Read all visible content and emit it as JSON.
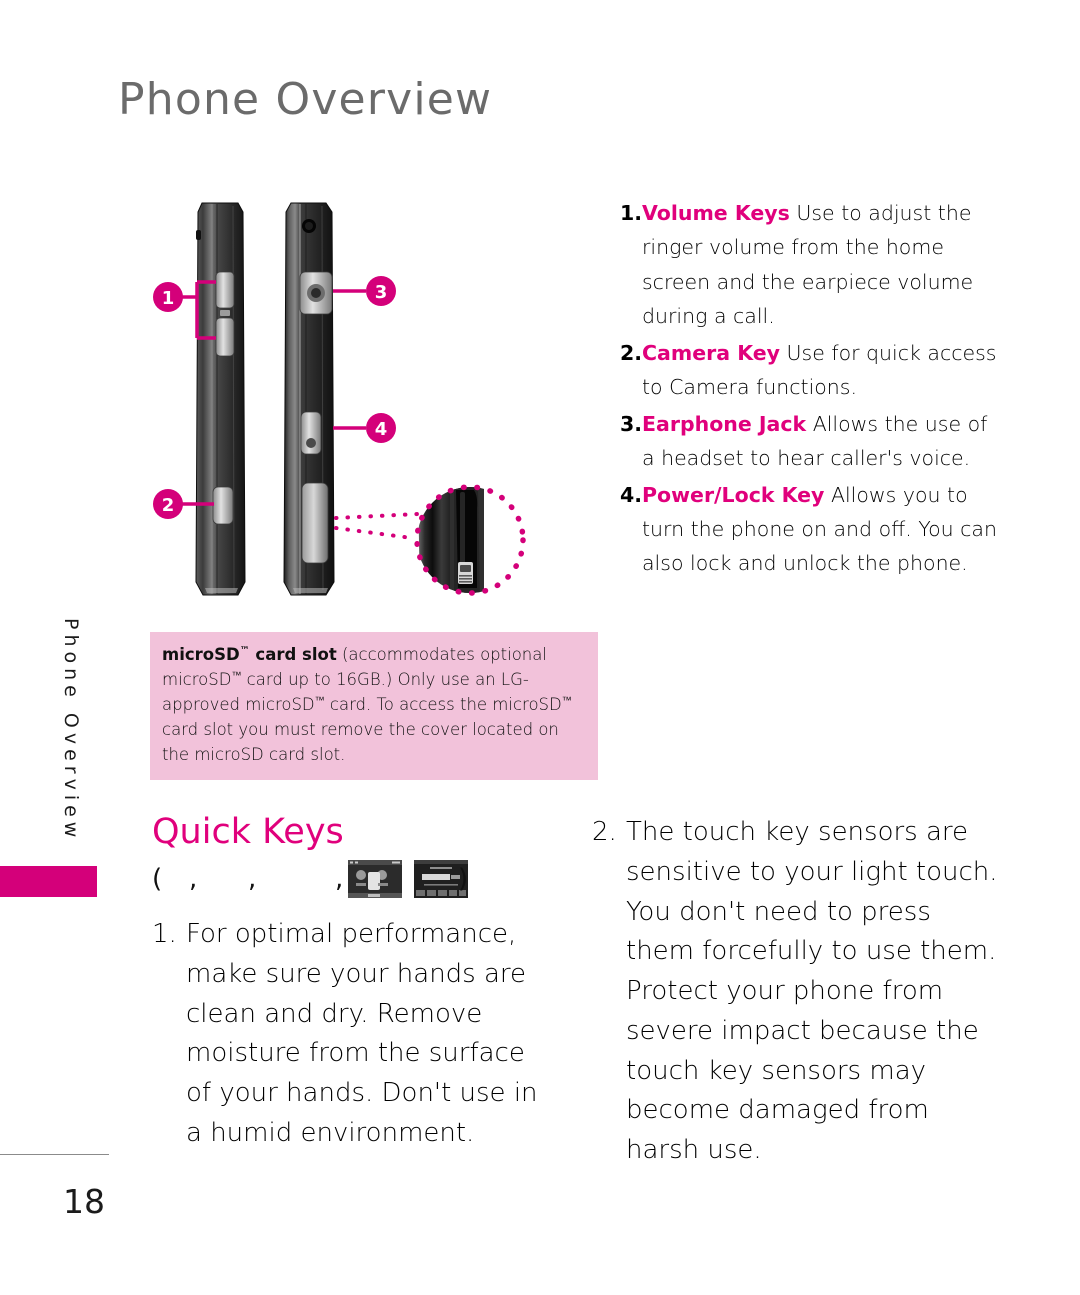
{
  "page": {
    "title": "Phone Overview",
    "side_tab_label": "Phone Overview",
    "page_number": "18"
  },
  "colors": {
    "magenta": "#e0007c",
    "tab_block": "#d4007a",
    "note_background": "#f2c2da",
    "title_gray": "#6b6b6b"
  },
  "illustration": {
    "callouts": [
      {
        "number": "1",
        "target": "volume-keys"
      },
      {
        "number": "2",
        "target": "camera-key"
      },
      {
        "number": "3",
        "target": "earphone-jack"
      },
      {
        "number": "4",
        "target": "power-lock-key"
      }
    ],
    "detail_circle": "microsd-card-slot-closeup"
  },
  "feature_list": [
    {
      "num": "1.",
      "label": "Volume Keys",
      "text": " Use to adjust the ringer volume from the home screen and the earpiece volume during a call."
    },
    {
      "num": "2.",
      "label": "Camera Key",
      "text": " Use for quick access to Camera functions."
    },
    {
      "num": "3.",
      "label": "Earphone Jack",
      "text": " Allows the use of a headset to hear caller's voice."
    },
    {
      "num": "4.",
      "label": "Power/Lock Key",
      "text": " Allows you to turn the phone on and off. You can also lock and unlock the phone."
    }
  ],
  "note": {
    "bold_lead": "microSD",
    "bold_lead_tm": "™",
    "bold_rest": " card slot",
    "body_1": " (accommodates optional microSD",
    "tm": "™",
    "body_2": " card up to 16GB.) Only use an LG-approved microSD",
    "body_3": " card. To access the microSD",
    "body_4": " card slot you must remove the cover located on the microSD card slot."
  },
  "quick_keys": {
    "heading": "Quick Keys",
    "paren_open": "(",
    "comma": ",",
    "paren_close": ")",
    "thumbnails": [
      {
        "name": "quick-key-screenshot-1"
      },
      {
        "name": "quick-key-screenshot-2"
      }
    ],
    "items": [
      {
        "num": "1.",
        "text": "For optimal performance, make sure your hands are clean and dry. Remove moisture from the surface of your hands. Don't use in a humid environment."
      },
      {
        "num": "2.",
        "text": "The touch key sensors are sensitive to your light touch. You don't need to press them forcefully to use them. Protect your phone from severe impact because the touch key sensors may become damaged from harsh use."
      }
    ]
  }
}
